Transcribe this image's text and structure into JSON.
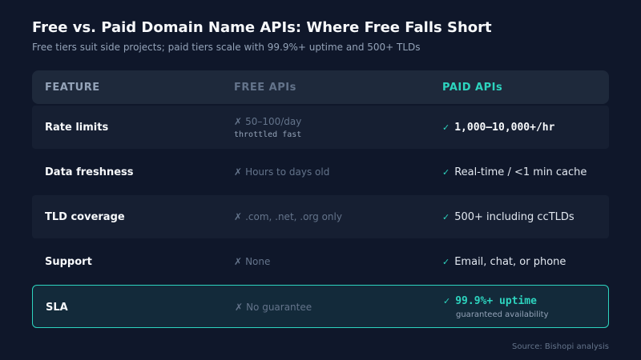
{
  "title": "Free vs. Paid Domain Name APIs: Where Free Falls Short",
  "subtitle": "Free tiers suit side projects; paid tiers scale with 99.9%+ uptime and 500+ TLDs",
  "headers": {
    "feature": "FEATURE",
    "free": "FREE APIs",
    "paid": "PAID APIs"
  },
  "marks": {
    "cross": "✗",
    "check": "✓"
  },
  "rows": [
    {
      "feature": "Rate limits",
      "free": "50–100/day",
      "free_sub": "throttled fast",
      "paid": "1,000–10,000+/hr"
    },
    {
      "feature": "Data freshness",
      "free": "Hours to days old",
      "paid": "Real-time / <1 min cache"
    },
    {
      "feature": "TLD coverage",
      "free": ".com, .net, .org only",
      "paid": "500+ including ccTLDs"
    },
    {
      "feature": "Support",
      "free": "None",
      "paid": "Email, chat, or phone"
    },
    {
      "feature": "SLA",
      "free": "No guarantee",
      "paid": "99.9%+ uptime",
      "paid_sub": "guaranteed availability"
    }
  ],
  "source": "Source: Bishopi analysis",
  "colors": {
    "accent": "#2dd4bf",
    "background": "#0f172a",
    "header_bg": "#1e293b"
  }
}
